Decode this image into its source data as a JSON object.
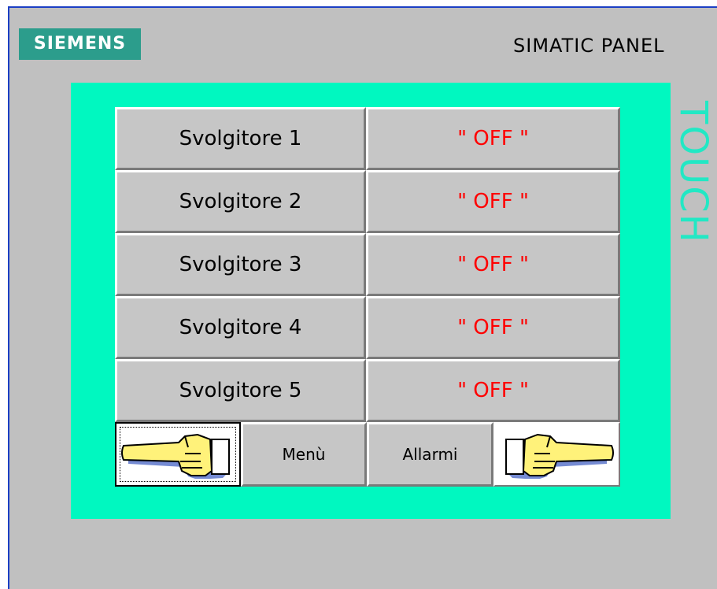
{
  "brand": {
    "logo_text": "SIEMENS",
    "model_text": "SIMATIC PANEL",
    "vertical_text": "TOUCH",
    "logo_color": "#2c9d8c",
    "touch_color": "#22e8c4",
    "screen_color": "#00f8c0",
    "frame_border_color": "#1c3fc4"
  },
  "unwinders": [
    {
      "name": "Svolgitore 1",
      "state": "\" OFF \""
    },
    {
      "name": "Svolgitore 2",
      "state": "\" OFF \""
    },
    {
      "name": "Svolgitore 3",
      "state": "\" OFF \""
    },
    {
      "name": "Svolgitore 4",
      "state": "\" OFF \""
    },
    {
      "name": "Svolgitore 5",
      "state": "\" OFF \""
    }
  ],
  "state_color": "#ff0000",
  "nav": {
    "prev_icon": "hand-pointing-left-icon",
    "menu_label": "Menù",
    "alarms_label": "Allarmi",
    "next_icon": "hand-pointing-right-icon"
  }
}
